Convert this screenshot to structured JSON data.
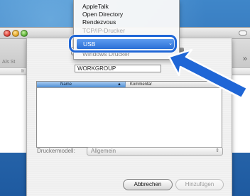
{
  "background_window": {
    "partial_label": "Als St",
    "overflow_chevron": "»",
    "list_partial_header": "Ir"
  },
  "sheet": {
    "protocol_popup": {
      "value": "Windows Drucker",
      "arrow": "▲▼"
    },
    "workgroup_field": {
      "value": "WORKGROUP"
    },
    "table": {
      "columns": [
        "Name",
        "Kommentar"
      ],
      "sort_indicator": "▲",
      "rows": []
    },
    "model": {
      "label": "Druckermodell:",
      "value": "Allgemein",
      "arrow": "⇕"
    },
    "buttons": {
      "cancel": "Abbrechen",
      "add": "Hinzufügen"
    }
  },
  "menu": {
    "items": [
      "AppleTalk",
      "Open Directory",
      "Rendezvous"
    ],
    "obscured_item": "TCP/IP-Drucker",
    "selected_item": "USB",
    "selected_arrow": "⌄"
  },
  "colors": {
    "highlight_ring": "#1f66d6",
    "callout_arrow": "#1f66d6",
    "selection": "#2a6fd6"
  },
  "icons": [
    "close-icon",
    "minimize-icon",
    "zoom-icon",
    "toolbar-toggle-icon",
    "callout-arrow-icon"
  ]
}
